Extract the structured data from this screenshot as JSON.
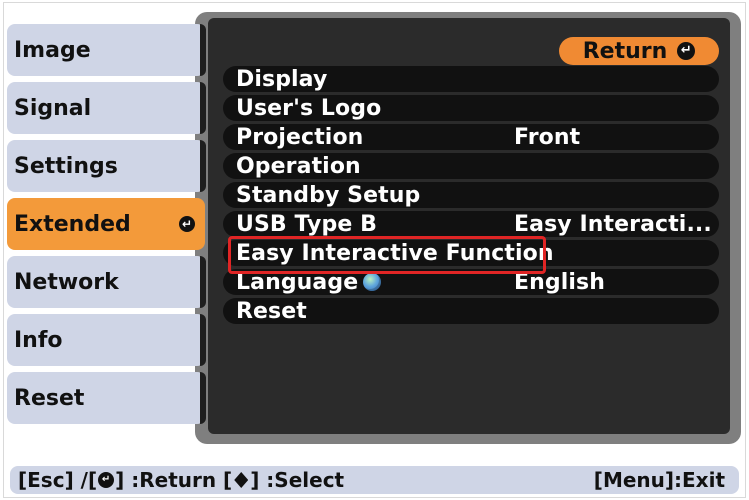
{
  "sidebar": {
    "items": [
      {
        "label": "Image"
      },
      {
        "label": "Signal"
      },
      {
        "label": "Settings"
      },
      {
        "label": "Extended",
        "active": true
      },
      {
        "label": "Network"
      },
      {
        "label": "Info"
      },
      {
        "label": "Reset"
      }
    ]
  },
  "header": {
    "return_label": "Return",
    "return_icon": "enter-icon"
  },
  "menu": {
    "items": [
      {
        "label": "Display",
        "value": ""
      },
      {
        "label": "User's Logo",
        "value": ""
      },
      {
        "label": "Projection",
        "value": "Front"
      },
      {
        "label": "Operation",
        "value": ""
      },
      {
        "label": "Standby Setup",
        "value": ""
      },
      {
        "label": "USB Type B",
        "value": "Easy Interacti..."
      },
      {
        "label": "Easy Interactive Function",
        "value": ""
      },
      {
        "label": "Language",
        "value": "English"
      },
      {
        "label": "Reset",
        "value": ""
      }
    ]
  },
  "footer": {
    "left_text_1": "[Esc] /[",
    "left_text_2": "] :Return [",
    "left_text_3": "] :Select",
    "right_text": "[Menu]:Exit"
  },
  "colors": {
    "panel_outer": "#7f7f7f",
    "panel_inner": "#2b2b2b",
    "tab_bg": "#cfd5e6",
    "tab_active": "#f39a3a",
    "return_button": "#f08a33",
    "highlight_outline": "#e02525"
  }
}
